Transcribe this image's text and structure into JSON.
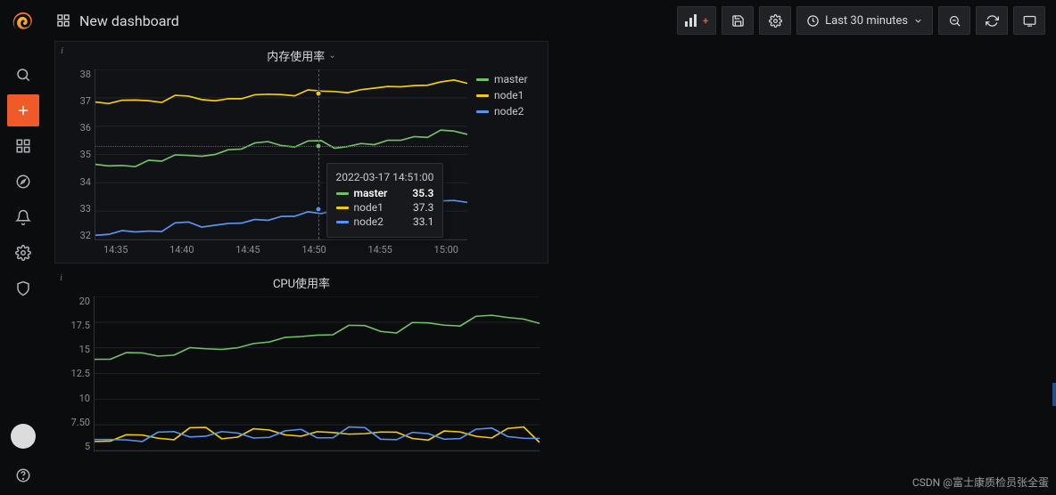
{
  "header": {
    "title": "New dashboard",
    "time_range": "Last 30 minutes"
  },
  "panels": {
    "panel1": {
      "title": "内存使用率",
      "legend": [
        {
          "name": "master",
          "color": "#73bf69"
        },
        {
          "name": "node1",
          "color": "#f2cc0c"
        },
        {
          "name": "node2",
          "color": "#5794f2"
        }
      ],
      "tooltip": {
        "time": "2022-03-17 14:51:00",
        "rows": [
          {
            "name": "master",
            "value": "35.3",
            "color": "#73bf69",
            "bold": true
          },
          {
            "name": "node1",
            "value": "37.3",
            "color": "#f2cc0c",
            "bold": false
          },
          {
            "name": "node2",
            "value": "33.1",
            "color": "#5794f2",
            "bold": false
          }
        ]
      },
      "y_ticks": [
        "38",
        "37",
        "36",
        "35",
        "34",
        "33",
        "32"
      ],
      "x_ticks": [
        "14:35",
        "14:40",
        "14:45",
        "14:50",
        "14:55",
        "15:00"
      ]
    },
    "panel2": {
      "title": "CPU使用率",
      "y_ticks": [
        "20",
        "17.5",
        "15",
        "12.5",
        "10",
        "7.50",
        "5"
      ]
    }
  },
  "chart_data": [
    {
      "type": "line",
      "title": "内存使用率",
      "xlabel": "",
      "ylabel": "",
      "ylim": [
        32,
        38
      ],
      "x_time": [
        "14:33",
        "14:35",
        "14:37",
        "14:39",
        "14:41",
        "14:43",
        "14:45",
        "14:47",
        "14:49",
        "14:51",
        "14:53",
        "14:55",
        "14:57",
        "14:59",
        "15:01"
      ],
      "series": [
        {
          "name": "master",
          "color": "#73bf69",
          "values": [
            34.7,
            34.6,
            34.8,
            34.9,
            35.0,
            35.2,
            35.4,
            35.3,
            35.4,
            35.3,
            35.4,
            35.5,
            35.6,
            35.8,
            35.8
          ]
        },
        {
          "name": "node1",
          "color": "#f2cc0c",
          "values": [
            36.9,
            36.9,
            36.9,
            37.0,
            37.0,
            37.0,
            37.1,
            37.1,
            37.2,
            37.3,
            37.3,
            37.4,
            37.4,
            37.5,
            37.6
          ]
        },
        {
          "name": "node2",
          "color": "#5794f2",
          "values": [
            32.2,
            32.3,
            32.3,
            32.5,
            32.5,
            32.6,
            32.7,
            32.8,
            32.9,
            33.1,
            33.0,
            33.1,
            33.2,
            33.3,
            33.4
          ]
        }
      ],
      "legend_position": "right",
      "grid": true
    },
    {
      "type": "line",
      "title": "CPU使用率",
      "xlabel": "",
      "ylabel": "",
      "ylim": [
        5,
        20
      ],
      "x_time": [
        "14:33",
        "14:35",
        "14:37",
        "14:39",
        "14:41",
        "14:43",
        "14:45",
        "14:47",
        "14:49",
        "14:51",
        "14:53",
        "14:55",
        "14:57",
        "14:59",
        "15:01"
      ],
      "series": [
        {
          "name": "master",
          "color": "#73bf69",
          "values": [
            14.0,
            14.5,
            14.2,
            14.8,
            15.0,
            15.5,
            16.0,
            16.2,
            17.0,
            16.8,
            17.5,
            17.2,
            18.0,
            17.8,
            17.6
          ]
        },
        {
          "name": "node1",
          "color": "#f2cc0c",
          "values": [
            6.0,
            6.5,
            6.2,
            7.0,
            6.3,
            7.2,
            6.5,
            6.8,
            6.4,
            7.0,
            6.2,
            6.9,
            6.3,
            7.0,
            6.0
          ]
        },
        {
          "name": "node2",
          "color": "#5794f2",
          "values": [
            6.2,
            6.0,
            6.8,
            6.1,
            7.0,
            6.3,
            6.9,
            6.2,
            7.1,
            6.3,
            6.8,
            6.1,
            7.0,
            6.2,
            6.4
          ]
        }
      ],
      "grid": true
    }
  ],
  "watermark": "CSDN @富士康质检员张全蛋"
}
